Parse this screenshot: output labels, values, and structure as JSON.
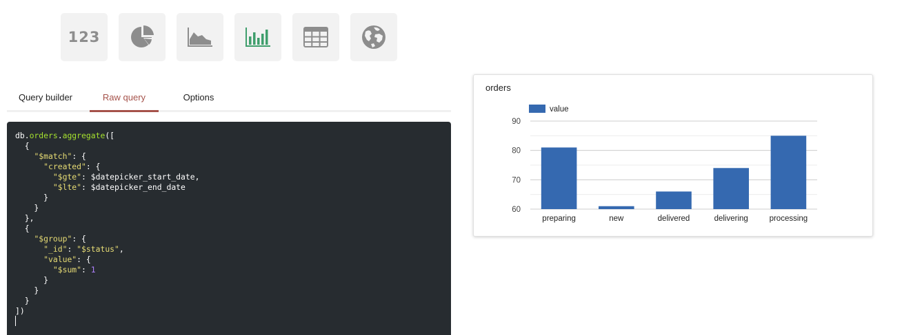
{
  "viz_types": [
    {
      "name": "number-icon",
      "label": "123",
      "color": "#8d8d8d",
      "selected": false
    },
    {
      "name": "pie-chart-icon",
      "color": "#8d8d8d",
      "selected": false
    },
    {
      "name": "area-chart-icon",
      "color": "#8d8d8d",
      "selected": false
    },
    {
      "name": "bar-chart-icon",
      "color": "#3f9e6c",
      "selected": true
    },
    {
      "name": "table-icon",
      "color": "#8d8d8d",
      "selected": false
    },
    {
      "name": "globe-icon",
      "color": "#8d8d8d",
      "selected": false
    }
  ],
  "tabs": [
    {
      "label": "Query builder",
      "active": false
    },
    {
      "label": "Raw query",
      "active": true
    },
    {
      "label": "Options",
      "active": false
    }
  ],
  "editor": {
    "language": "mongodb",
    "lines": [
      "db.orders.aggregate([",
      "  {",
      "    \"$match\": {",
      "      \"created\": {",
      "        \"$gte\": $datepicker_start_date,",
      "        \"$lte\": $datepicker_end_date",
      "      }",
      "    }",
      "  },",
      "  {",
      "    \"$group\": {",
      "      \"_id\": \"$status\",",
      "      \"value\": {",
      "        \"$sum\": 1",
      "      }",
      "    }",
      "  }",
      "])"
    ]
  },
  "chart_card": {
    "title": "orders"
  },
  "chart_data": {
    "type": "bar",
    "title": "orders",
    "categories": [
      "preparing",
      "new",
      "delivered",
      "delivering",
      "processing"
    ],
    "series": [
      {
        "name": "value",
        "values": [
          81,
          61,
          66,
          74,
          85
        ],
        "color": "#3569b0"
      }
    ],
    "yticks": [
      "60",
      "70",
      "80",
      "90"
    ],
    "ylim": [
      60,
      90
    ],
    "grid": true,
    "legend": "top-left"
  }
}
